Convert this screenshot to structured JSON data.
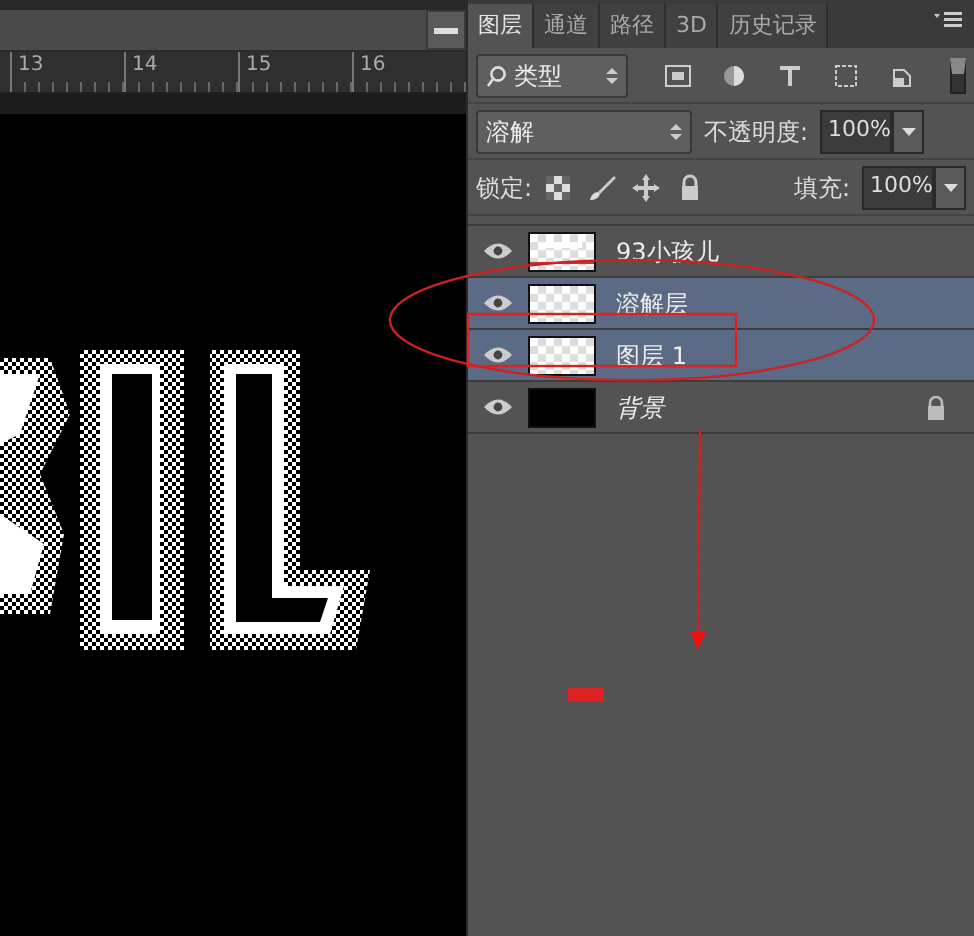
{
  "ruler": {
    "labels": [
      "13",
      "14",
      "15",
      "16"
    ]
  },
  "panel": {
    "tabs": [
      {
        "label": "图层",
        "selected": true
      },
      {
        "label": "通道",
        "selected": false
      },
      {
        "label": "路径",
        "selected": false
      },
      {
        "label": "3D",
        "selected": false
      },
      {
        "label": "历史记录",
        "selected": false
      }
    ],
    "filter": {
      "value": "类型"
    },
    "blend_mode": {
      "value": "溶解"
    },
    "opacity": {
      "label": "不透明度:",
      "value": "100%"
    },
    "lock": {
      "label": "锁定:"
    },
    "fill": {
      "label": "填充:",
      "value": "100%"
    },
    "layers": [
      {
        "name": "93小孩儿",
        "kind": "text",
        "selected": false,
        "visible": true,
        "locked": false
      },
      {
        "name": "溶解层",
        "kind": "transparent",
        "selected": true,
        "visible": true,
        "locked": false
      },
      {
        "name": "图层 1",
        "kind": "transparent",
        "selected": true,
        "visible": true,
        "locked": false
      },
      {
        "name": "背景",
        "kind": "background",
        "selected": false,
        "visible": true,
        "locked": true
      }
    ]
  }
}
